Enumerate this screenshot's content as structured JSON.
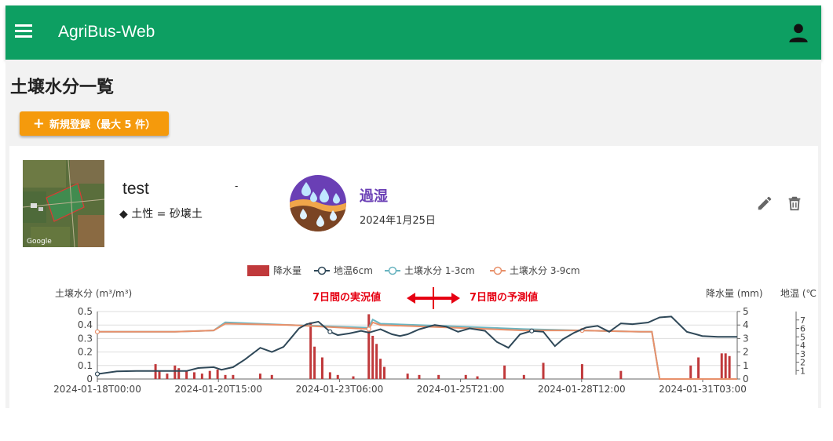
{
  "app": {
    "title": "AgriBus-Web",
    "menu_icon": "menu-icon",
    "user_icon": "account-icon",
    "brand_color": "#0d9f62"
  },
  "page": {
    "title": "土壌水分一覧",
    "add_button_label": "新規登録（最大 5 件）",
    "add_button_color": "#f59a0c"
  },
  "card": {
    "field_name": "test",
    "dash": "-",
    "soil_label": "◆ 土性 = 砂壌土",
    "map_attribution": "Google",
    "status_label": "過湿",
    "status_date": "2024年1月25日",
    "status_color": "#6a3fb5",
    "edit_icon": "pencil-icon",
    "delete_icon": "trash-icon"
  },
  "chart_data": {
    "type": "line",
    "legend": [
      "降水量",
      "地温6cm",
      "土壌水分 1-3cm",
      "土壌水分 3-9cm"
    ],
    "legend_placement": "top",
    "ylabel_left": "土壌水分 (m³/m³)",
    "ylabel_right": "降水量 (mm)",
    "ylabel_far_right": "地温 (℃",
    "annotation_left": "7日間の実況値",
    "annotation_right": "7日間の予測値",
    "x_tick_labels": [
      "2024-01-18T00:00",
      "2024-01-20T15:00",
      "2024-01-23T06:00",
      "2024-01-25T21:00",
      "2024-01-28T12:00",
      "2024-01-31T03:00"
    ],
    "y_left_ticks": [
      "0",
      "0.1",
      "0.2",
      "0.3",
      "0.4",
      "0.5"
    ],
    "y_right_ticks": [
      "0",
      "1",
      "2",
      "3",
      "4",
      "5"
    ],
    "y_far_right_ticks": [
      "1",
      "2",
      "3",
      "4",
      "5",
      "6",
      "7"
    ],
    "y_left_range": [
      0,
      0.5
    ],
    "y_right_range": [
      0,
      5
    ],
    "y_far_right_range": [
      0,
      8
    ],
    "x_range_days": [
      0,
      16.5
    ],
    "grid": true,
    "colors": {
      "rain": "#c0393b",
      "soil_temp": "#2f4858",
      "moisture_1_3": "#6ab4c0",
      "moisture_3_9": "#e8906a",
      "annotation": "#e60012"
    },
    "series": [
      {
        "name": "地温6cm",
        "axis": "far-right",
        "x": [
          0,
          0.5,
          1,
          1.5,
          2,
          2.3,
          2.6,
          3,
          3.2,
          3.5,
          3.8,
          4.2,
          4.5,
          4.8,
          5.0,
          5.2,
          5.4,
          5.7,
          6.0,
          6.2,
          6.5,
          6.8,
          7.0,
          7.3,
          7.6,
          7.8,
          8.0,
          8.3,
          8.7,
          9.0,
          9.3,
          9.6,
          10.0,
          10.3,
          10.6,
          10.9,
          11.2,
          11.5,
          11.8,
          12.0,
          12.3,
          12.6,
          12.9,
          13.2,
          13.5,
          13.8,
          14.2,
          14.5,
          14.8,
          15.2,
          15.6,
          16.0,
          16.2,
          16.5
        ],
        "values": [
          0.6,
          0.9,
          0.95,
          0.95,
          0.95,
          0.95,
          1.3,
          1.4,
          1.1,
          1.4,
          2.3,
          3.7,
          3.2,
          3.8,
          4.9,
          6.0,
          6.5,
          6.8,
          5.6,
          5.2,
          5.4,
          5.7,
          5.5,
          5.9,
          5.3,
          5.1,
          5.3,
          5.9,
          6.4,
          6.2,
          5.6,
          6.0,
          5.7,
          4.4,
          3.7,
          5.3,
          5.7,
          5.6,
          3.9,
          4.7,
          5.5,
          6.1,
          6.3,
          5.6,
          6.6,
          6.5,
          6.7,
          7.3,
          7.4,
          5.6,
          5.1,
          5.0,
          5.0,
          5.0
        ]
      },
      {
        "name": "土壌水分 1-3cm",
        "axis": "left",
        "x": [
          0,
          2,
          3,
          3.3,
          5,
          7.0,
          7.1,
          7.3,
          9.2,
          11,
          12.5,
          14.0,
          14.3,
          14.5,
          16.5
        ],
        "values": [
          0.35,
          0.35,
          0.36,
          0.42,
          0.4,
          0.38,
          0.44,
          0.41,
          0.39,
          0.37,
          0.36,
          0.35,
          0.35,
          0.0,
          0.0
        ]
      },
      {
        "name": "土壌水分 3-9cm",
        "axis": "left",
        "x": [
          0,
          2,
          3,
          3.3,
          5,
          7.0,
          7.1,
          7.3,
          9.2,
          11,
          12.5,
          14.0,
          14.3,
          14.5,
          16.5
        ],
        "values": [
          0.35,
          0.35,
          0.36,
          0.41,
          0.4,
          0.37,
          0.42,
          0.4,
          0.38,
          0.36,
          0.36,
          0.35,
          0.35,
          0.0,
          0.0
        ]
      },
      {
        "name": "降水量",
        "axis": "right",
        "x": [
          1.5,
          1.6,
          1.8,
          2.0,
          2.1,
          2.3,
          2.5,
          2.7,
          2.9,
          3.1,
          3.3,
          3.5,
          4.2,
          4.5,
          5.5,
          5.6,
          5.8,
          6.0,
          6.2,
          6.6,
          7.0,
          7.1,
          7.2,
          7.3,
          7.4,
          8.0,
          8.3,
          8.8,
          9.5,
          9.8,
          10.5,
          11.0,
          11.5,
          12.5,
          13.5,
          15.3,
          15.5,
          16.1,
          16.2,
          16.3
        ],
        "values": [
          1.1,
          0.6,
          0.4,
          1.0,
          0.8,
          0.6,
          0.5,
          0.4,
          0.6,
          0.7,
          0.3,
          0.3,
          0.4,
          0.3,
          4.2,
          2.4,
          1.6,
          0.5,
          0.3,
          0.2,
          4.8,
          3.2,
          2.6,
          1.5,
          0.9,
          0.4,
          0.3,
          0.3,
          0.3,
          0.2,
          1.0,
          0.3,
          1.2,
          1.1,
          0.6,
          1.0,
          1.6,
          1.9,
          1.9,
          1.7
        ]
      }
    ]
  }
}
